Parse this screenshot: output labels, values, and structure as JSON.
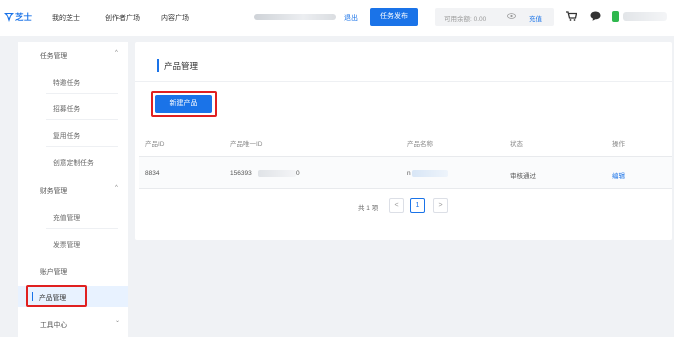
{
  "header": {
    "logo_text": "芝士",
    "nav": [
      "我的芝士",
      "创作者广场",
      "内容广场"
    ],
    "logout": "退出",
    "publish_button": "任务发布",
    "balance_label": "可用余额: 0.00",
    "recharge": "充值",
    "icons": [
      "logo-icon",
      "eye-icon",
      "cart-icon",
      "chat-icon"
    ]
  },
  "sidebar": {
    "groups": [
      {
        "label": "任务管理",
        "expanded": true,
        "items": [
          "特邀任务",
          "招募任务",
          "复用任务",
          "创意定制任务"
        ]
      },
      {
        "label": "财务管理",
        "expanded": true,
        "items": [
          "充值管理",
          "发票管理"
        ]
      },
      {
        "label": "账户管理"
      },
      {
        "label": "产品管理",
        "active": true
      },
      {
        "label": "工具中心",
        "expanded": false
      }
    ],
    "chevron_up": "^",
    "chevron_down": "⌄"
  },
  "main": {
    "title": "产品管理",
    "new_button": "新建产品",
    "columns": [
      "产品ID",
      "产品唯一ID",
      "产品名称",
      "状态",
      "操作"
    ],
    "rows": [
      {
        "id": "8834",
        "uid_prefix": "156393",
        "uid_suffix": "0",
        "name_prefix": "n",
        "status": "审核通过",
        "action": "编辑"
      }
    ],
    "pagination": {
      "total": "共 1 项",
      "prev": "<",
      "current": "1",
      "next": ">"
    }
  },
  "colors": {
    "accent": "#1a73e8",
    "highlight": "#e02020",
    "background": "#f0f2f5",
    "active_bg": "#e8f2ff"
  }
}
